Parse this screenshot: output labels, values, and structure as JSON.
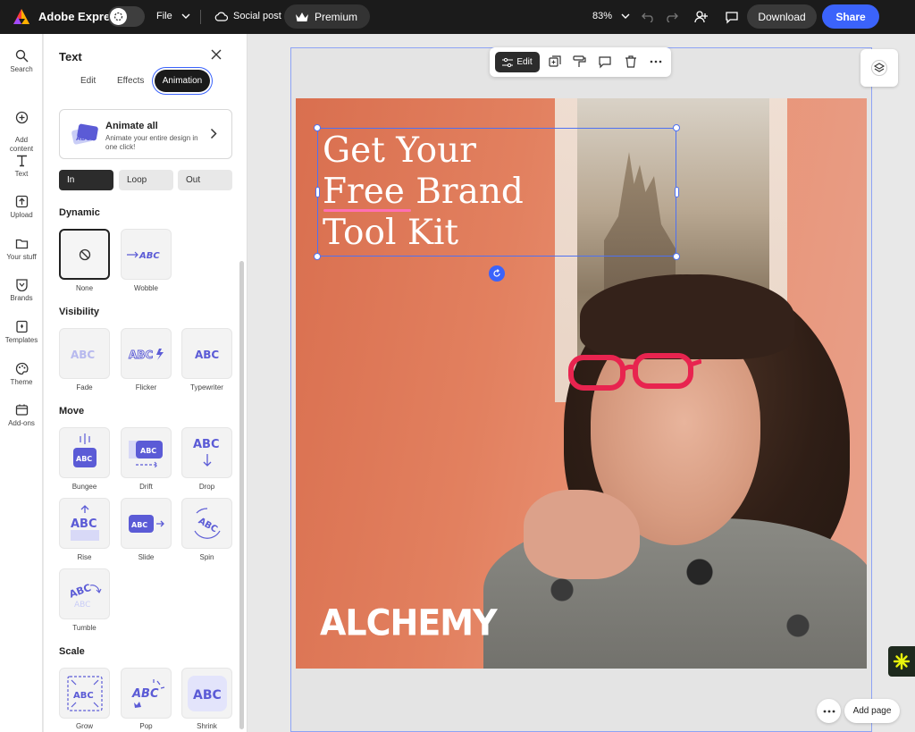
{
  "topbar": {
    "app_title": "Adobe Express",
    "file_label": "File",
    "doc_type": "Social post",
    "premium_label": "Premium",
    "zoom": "83%",
    "download_label": "Download",
    "share_label": "Share"
  },
  "rail": {
    "items": [
      {
        "label": "Search",
        "icon": "search-icon"
      },
      {
        "label": "Add\ncontent",
        "icon": "plus-circle-icon"
      },
      {
        "label": "Text",
        "icon": "text-icon"
      },
      {
        "label": "Upload",
        "icon": "upload-icon"
      },
      {
        "label": "Your stuff",
        "icon": "folder-icon"
      },
      {
        "label": "Brands",
        "icon": "brand-icon"
      },
      {
        "label": "Templates",
        "icon": "templates-icon"
      },
      {
        "label": "Theme",
        "icon": "palette-icon"
      },
      {
        "label": "Add-ons",
        "icon": "addons-icon"
      }
    ]
  },
  "panel": {
    "title": "Text",
    "tabs": [
      "Edit",
      "Effects",
      "Animation"
    ],
    "active_tab": "Animation",
    "animate_all": {
      "title": "Animate all",
      "desc": "Animate your entire design in one click!"
    },
    "segments": [
      "In",
      "Loop",
      "Out"
    ],
    "active_segment": "In",
    "sections": {
      "dynamic": "Dynamic",
      "visibility": "Visibility",
      "move": "Move",
      "scale": "Scale"
    },
    "presets": {
      "none": "None",
      "wobble": "Wobble",
      "fade": "Fade",
      "flicker": "Flicker",
      "typewriter": "Typewriter",
      "bungee": "Bungee",
      "drift": "Drift",
      "drop": "Drop",
      "rise": "Rise",
      "slide": "Slide",
      "spin": "Spin",
      "tumble": "Tumble",
      "grow": "Grow",
      "pop": "Pop",
      "shrink": "Shrink"
    },
    "tile_text": "ABC"
  },
  "toolbar": {
    "edit_label": "Edit"
  },
  "canvas": {
    "headline_lines": [
      "Get Your",
      "Free Brand",
      "Tool Kit"
    ],
    "brand_logo": "ALCHEMY"
  },
  "footer": {
    "add_page_label": "Add page"
  },
  "colors": {
    "accent": "#3b63fb",
    "tile_purple": "#5b5bd6",
    "underline_pink": "#ff6fb3"
  }
}
